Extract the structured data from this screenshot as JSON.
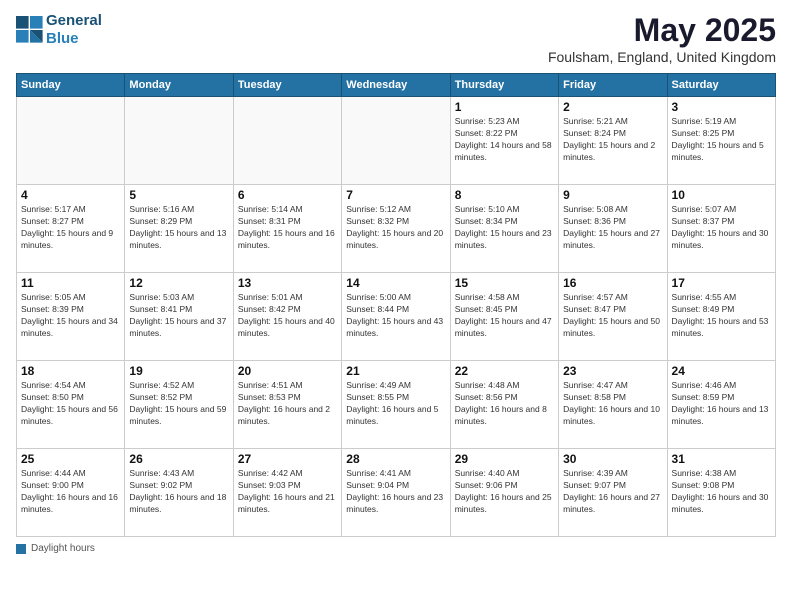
{
  "header": {
    "logo_line1": "General",
    "logo_line2": "Blue",
    "month": "May 2025",
    "location": "Foulsham, England, United Kingdom"
  },
  "columns": [
    "Sunday",
    "Monday",
    "Tuesday",
    "Wednesday",
    "Thursday",
    "Friday",
    "Saturday"
  ],
  "weeks": [
    [
      {
        "day": "",
        "info": ""
      },
      {
        "day": "",
        "info": ""
      },
      {
        "day": "",
        "info": ""
      },
      {
        "day": "",
        "info": ""
      },
      {
        "day": "1",
        "info": "Sunrise: 5:23 AM\nSunset: 8:22 PM\nDaylight: 14 hours and 58 minutes."
      },
      {
        "day": "2",
        "info": "Sunrise: 5:21 AM\nSunset: 8:24 PM\nDaylight: 15 hours and 2 minutes."
      },
      {
        "day": "3",
        "info": "Sunrise: 5:19 AM\nSunset: 8:25 PM\nDaylight: 15 hours and 5 minutes."
      }
    ],
    [
      {
        "day": "4",
        "info": "Sunrise: 5:17 AM\nSunset: 8:27 PM\nDaylight: 15 hours and 9 minutes."
      },
      {
        "day": "5",
        "info": "Sunrise: 5:16 AM\nSunset: 8:29 PM\nDaylight: 15 hours and 13 minutes."
      },
      {
        "day": "6",
        "info": "Sunrise: 5:14 AM\nSunset: 8:31 PM\nDaylight: 15 hours and 16 minutes."
      },
      {
        "day": "7",
        "info": "Sunrise: 5:12 AM\nSunset: 8:32 PM\nDaylight: 15 hours and 20 minutes."
      },
      {
        "day": "8",
        "info": "Sunrise: 5:10 AM\nSunset: 8:34 PM\nDaylight: 15 hours and 23 minutes."
      },
      {
        "day": "9",
        "info": "Sunrise: 5:08 AM\nSunset: 8:36 PM\nDaylight: 15 hours and 27 minutes."
      },
      {
        "day": "10",
        "info": "Sunrise: 5:07 AM\nSunset: 8:37 PM\nDaylight: 15 hours and 30 minutes."
      }
    ],
    [
      {
        "day": "11",
        "info": "Sunrise: 5:05 AM\nSunset: 8:39 PM\nDaylight: 15 hours and 34 minutes."
      },
      {
        "day": "12",
        "info": "Sunrise: 5:03 AM\nSunset: 8:41 PM\nDaylight: 15 hours and 37 minutes."
      },
      {
        "day": "13",
        "info": "Sunrise: 5:01 AM\nSunset: 8:42 PM\nDaylight: 15 hours and 40 minutes."
      },
      {
        "day": "14",
        "info": "Sunrise: 5:00 AM\nSunset: 8:44 PM\nDaylight: 15 hours and 43 minutes."
      },
      {
        "day": "15",
        "info": "Sunrise: 4:58 AM\nSunset: 8:45 PM\nDaylight: 15 hours and 47 minutes."
      },
      {
        "day": "16",
        "info": "Sunrise: 4:57 AM\nSunset: 8:47 PM\nDaylight: 15 hours and 50 minutes."
      },
      {
        "day": "17",
        "info": "Sunrise: 4:55 AM\nSunset: 8:49 PM\nDaylight: 15 hours and 53 minutes."
      }
    ],
    [
      {
        "day": "18",
        "info": "Sunrise: 4:54 AM\nSunset: 8:50 PM\nDaylight: 15 hours and 56 minutes."
      },
      {
        "day": "19",
        "info": "Sunrise: 4:52 AM\nSunset: 8:52 PM\nDaylight: 15 hours and 59 minutes."
      },
      {
        "day": "20",
        "info": "Sunrise: 4:51 AM\nSunset: 8:53 PM\nDaylight: 16 hours and 2 minutes."
      },
      {
        "day": "21",
        "info": "Sunrise: 4:49 AM\nSunset: 8:55 PM\nDaylight: 16 hours and 5 minutes."
      },
      {
        "day": "22",
        "info": "Sunrise: 4:48 AM\nSunset: 8:56 PM\nDaylight: 16 hours and 8 minutes."
      },
      {
        "day": "23",
        "info": "Sunrise: 4:47 AM\nSunset: 8:58 PM\nDaylight: 16 hours and 10 minutes."
      },
      {
        "day": "24",
        "info": "Sunrise: 4:46 AM\nSunset: 8:59 PM\nDaylight: 16 hours and 13 minutes."
      }
    ],
    [
      {
        "day": "25",
        "info": "Sunrise: 4:44 AM\nSunset: 9:00 PM\nDaylight: 16 hours and 16 minutes."
      },
      {
        "day": "26",
        "info": "Sunrise: 4:43 AM\nSunset: 9:02 PM\nDaylight: 16 hours and 18 minutes."
      },
      {
        "day": "27",
        "info": "Sunrise: 4:42 AM\nSunset: 9:03 PM\nDaylight: 16 hours and 21 minutes."
      },
      {
        "day": "28",
        "info": "Sunrise: 4:41 AM\nSunset: 9:04 PM\nDaylight: 16 hours and 23 minutes."
      },
      {
        "day": "29",
        "info": "Sunrise: 4:40 AM\nSunset: 9:06 PM\nDaylight: 16 hours and 25 minutes."
      },
      {
        "day": "30",
        "info": "Sunrise: 4:39 AM\nSunset: 9:07 PM\nDaylight: 16 hours and 27 minutes."
      },
      {
        "day": "31",
        "info": "Sunrise: 4:38 AM\nSunset: 9:08 PM\nDaylight: 16 hours and 30 minutes."
      }
    ]
  ],
  "footer": {
    "daylight_label": "Daylight hours"
  }
}
